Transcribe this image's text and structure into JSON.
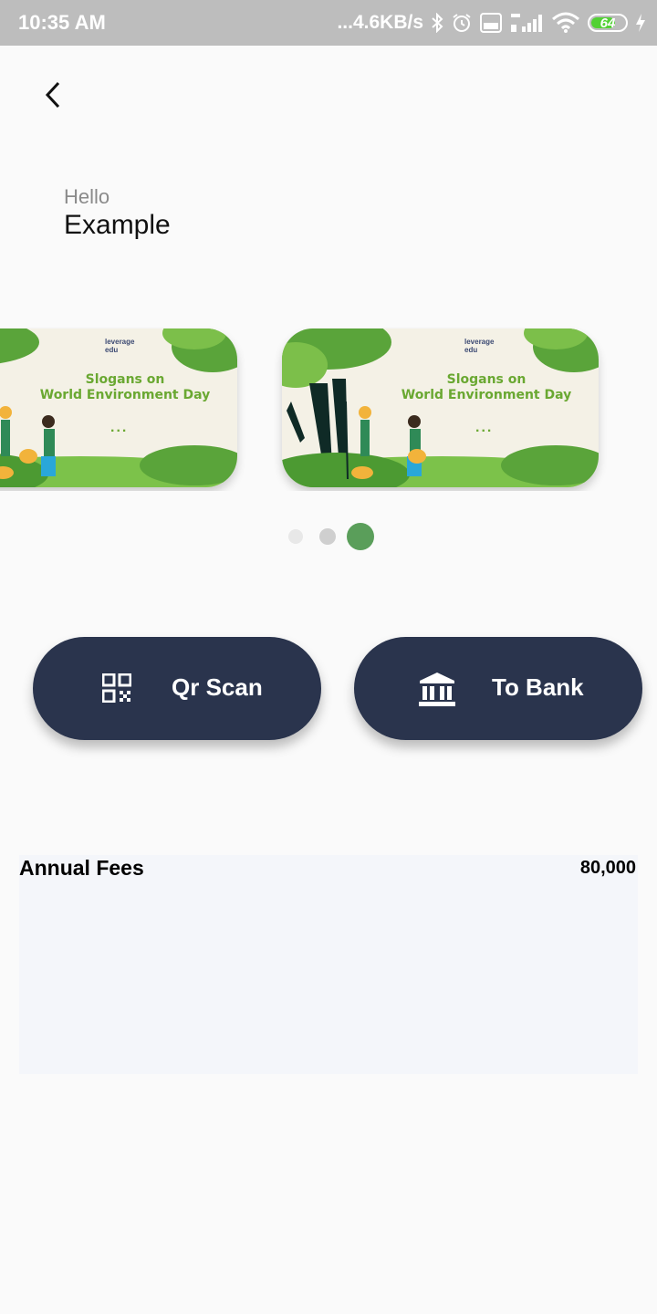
{
  "status_bar": {
    "time": "10:35 AM",
    "network_speed": "...4.6KB/s",
    "battery_level": "64",
    "icons": [
      "bluetooth-icon",
      "alarm-icon",
      "volte-icon",
      "signal-4g-icon",
      "wifi-icon",
      "battery-icon",
      "charging-icon"
    ]
  },
  "header": {
    "back_icon": "chevron-left-icon"
  },
  "greeting": {
    "salutation": "Hello",
    "name": "Example"
  },
  "carousel": {
    "slides": [
      {
        "logo_text": "leverage\nedu",
        "title_line1": "Slogans on",
        "title_line2": "World Environment Day",
        "dots": "..."
      },
      {
        "logo_text": "leverage\nedu",
        "title_line1": "Slogans on",
        "title_line2": "World Environment Day",
        "dots": "..."
      }
    ],
    "page_count": 3,
    "active_index": 2,
    "active_color": "#5a9e5a",
    "inactive_colors": [
      "#e8e8e8",
      "#cfcfcf"
    ]
  },
  "actions": {
    "qr_scan": {
      "label": "Qr Scan",
      "icon": "qr-code-icon"
    },
    "to_bank": {
      "label": "To Bank",
      "icon": "bank-icon"
    },
    "button_color": "#2a344d"
  },
  "fees": {
    "label": "Annual Fees",
    "value": "80,000"
  }
}
